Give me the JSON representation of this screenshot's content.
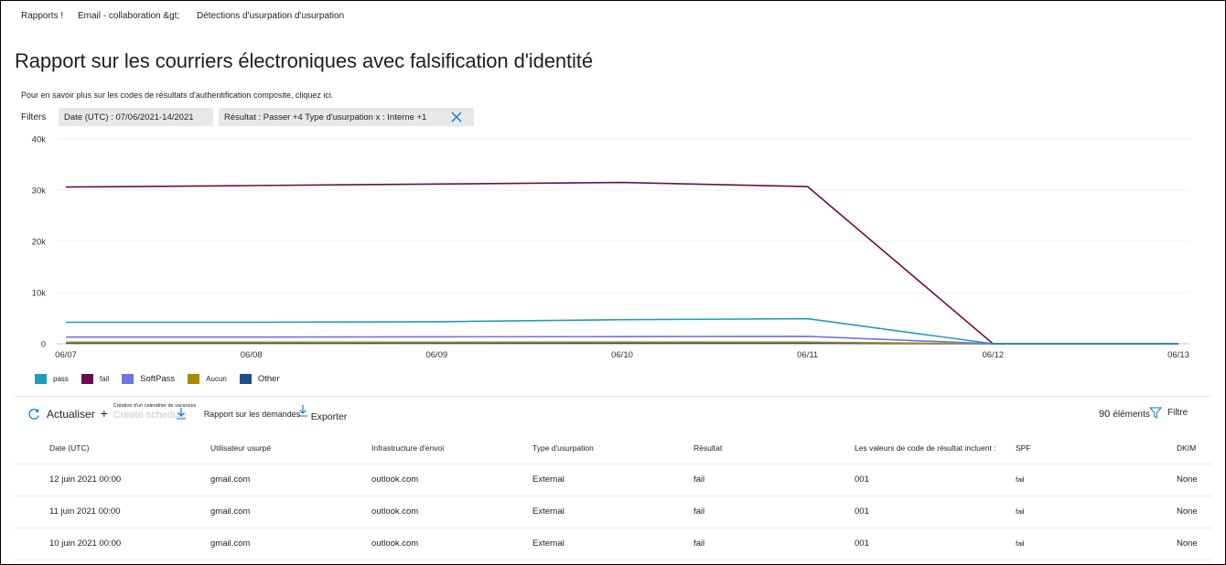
{
  "breadcrumb": [
    "Rapports !",
    "Email - collaboration &gt;",
    "Détections d'usurpation d'usurpation"
  ],
  "page_title": "Rapport sur les courriers électroniques avec falsification d'identité",
  "info_link": "Pour en savoir plus sur les codes de résultats d'authentification composite, cliquez ici.",
  "filters": {
    "label": "Filters",
    "date_chip": "Date (UTC) : 07/06/2021-14/2021",
    "result_chip": "Résultat : Passer +4  Type d'usurpation x : Interne +1"
  },
  "chart_data": {
    "type": "line",
    "categories": [
      "06/07",
      "06/08",
      "06/09",
      "06/10",
      "06/11",
      "06/12",
      "06/13"
    ],
    "y_ticks": [
      "0",
      "10k",
      "20k",
      "30k",
      "40k"
    ],
    "ylim": [
      0,
      40000
    ],
    "grid": true,
    "legend_position": "bottom-left",
    "series": [
      {
        "name": "pass",
        "color": "#1f9bbf",
        "values": [
          4200,
          4200,
          4300,
          4700,
          4900,
          0,
          0
        ]
      },
      {
        "name": "fail",
        "color": "#6e0b4d",
        "values": [
          30600,
          30900,
          31200,
          31500,
          30700,
          0,
          0
        ]
      },
      {
        "name": "SoftPass",
        "color": "#6b76e0",
        "values": [
          1300,
          1300,
          1350,
          1400,
          1450,
          0,
          0
        ]
      },
      {
        "name": "Aucun",
        "color": "#a88a00",
        "values": [
          300,
          300,
          300,
          320,
          320,
          0,
          0
        ]
      },
      {
        "name": "Other",
        "color": "#1f4e8c",
        "values": [
          100,
          100,
          100,
          100,
          100,
          0,
          0
        ]
      }
    ]
  },
  "toolbar": {
    "refresh": "Actualiser",
    "schedule_tiny": "Création d'un calendrier de vacances",
    "schedule_ghost": "Create schedule",
    "request_report": "Rapport sur les demandes",
    "export": "Exporter"
  },
  "count": {
    "number": "90",
    "label": "éléments"
  },
  "filter_button": "Filtre",
  "table": {
    "headers": [
      "Date (UTC)",
      "Utilisateur usurpé",
      "Infrastructure d'envoi",
      "Type d'usurpation",
      "Résultat",
      "Les valeurs de code de résultat incluent :",
      "SPF",
      "DKIM"
    ],
    "rows": [
      [
        "12 juin 2021 00:00",
        "gmail.com",
        "outlook.com",
        "External",
        "fail",
        "001",
        "fail",
        "None"
      ],
      [
        "11 juin 2021 00:00",
        "gmail.com",
        "outlook.com",
        "External",
        "fail",
        "001",
        "fail",
        "None"
      ],
      [
        "10 juin 2021 00:00",
        "gmail.com",
        "outlook.com",
        "External",
        "fail",
        "001",
        "fail",
        "None"
      ]
    ]
  }
}
